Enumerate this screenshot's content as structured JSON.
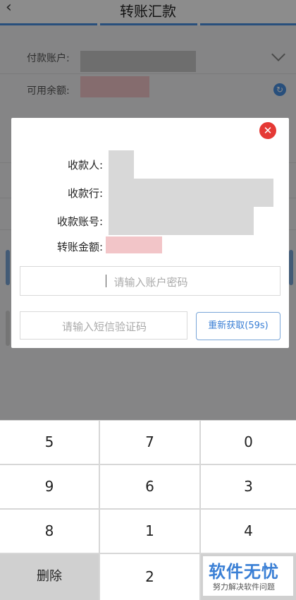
{
  "nav": {
    "title": "转账汇款",
    "back_icon": "‹"
  },
  "background": {
    "payer_label": "付款账户:",
    "balance_label": "可用余额:"
  },
  "dialog": {
    "close_icon": "✕",
    "rows": [
      {
        "label": "收款人:"
      },
      {
        "label": "收款行:"
      },
      {
        "label": "收款账号:"
      },
      {
        "label": "转账金额:"
      }
    ],
    "password_placeholder": "请输入账户密码",
    "sms_placeholder": "请输入短信验证码",
    "resend_label": "重新获取(59s)"
  },
  "keypad": {
    "keys": [
      "5",
      "7",
      "0",
      "9",
      "6",
      "3",
      "8",
      "1",
      "4",
      "删除",
      "2"
    ]
  },
  "watermark": {
    "title": "软件无忧",
    "subtitle": "努力解决软件问题"
  },
  "colors": {
    "accent": "#4a90e2",
    "close": "#e53935",
    "mask_grey": "#c8c8c8",
    "mask_pink": "#f2c5c8"
  }
}
